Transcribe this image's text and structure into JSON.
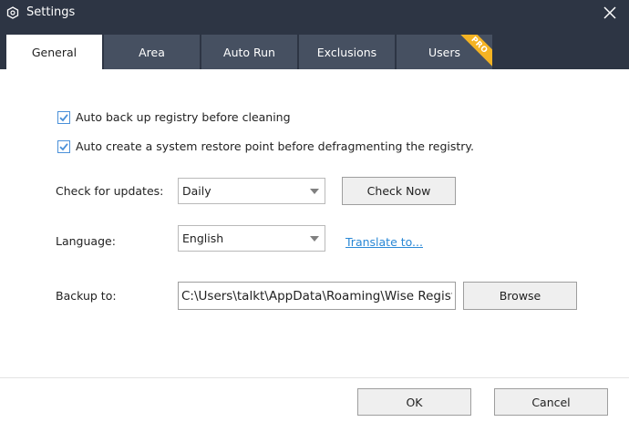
{
  "window": {
    "title": "Settings"
  },
  "tabs": [
    {
      "label": "General",
      "active": true
    },
    {
      "label": "Area",
      "active": false
    },
    {
      "label": "Auto Run",
      "active": false
    },
    {
      "label": "Exclusions",
      "active": false
    },
    {
      "label": "Users",
      "active": false,
      "badge": "PRO"
    }
  ],
  "general": {
    "backup_registry": {
      "label": "Auto back up registry before cleaning",
      "checked": true
    },
    "restore_point": {
      "label": "Auto create a system restore point before defragmenting the registry.",
      "checked": true
    },
    "updates": {
      "label": "Check for updates:",
      "value": "Daily",
      "button": "Check Now"
    },
    "language": {
      "label": "Language:",
      "value": "English",
      "link": "Translate to..."
    },
    "backup": {
      "label": "Backup to:",
      "path": "C:\\Users\\talkt\\AppData\\Roaming\\Wise Registry",
      "button": "Browse"
    }
  },
  "footer": {
    "ok": "OK",
    "cancel": "Cancel"
  },
  "colors": {
    "titlebar": "#2d3544",
    "tab_inactive": "#465061",
    "accent": "#4a90d9",
    "link": "#2a88d6",
    "pro_badge": "#f4b323"
  }
}
